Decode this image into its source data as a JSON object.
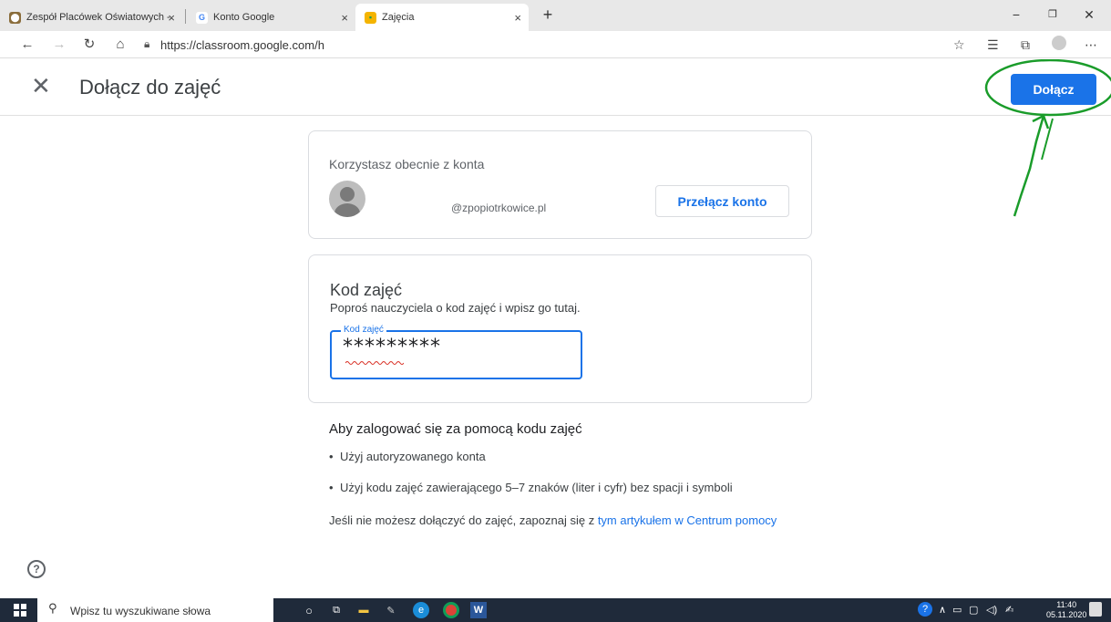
{
  "browser": {
    "tabs": [
      {
        "title": "Zespół Placówek Oświatowych -",
        "favicon": "school-favicon"
      },
      {
        "title": "Konto Google",
        "favicon": "google-favicon",
        "favicon_text": "G"
      },
      {
        "title": "Zajęcia",
        "favicon": "classroom-favicon",
        "active": true
      }
    ],
    "tab_close": "×",
    "new_tab": "+",
    "url": "https://classroom.google.com/h"
  },
  "page": {
    "title": "Dołącz do zajęć",
    "join_button": "Dołącz",
    "account_card": {
      "label": "Korzystasz obecnie z konta",
      "email": "@zpopiotrkowice.pl",
      "switch_button": "Przełącz konto"
    },
    "code_card": {
      "title": "Kod zajęć",
      "subtitle": "Poproś nauczyciela o kod zajęć i wpisz go tutaj.",
      "field_label": "Kod zajęć",
      "field_value": "*********"
    },
    "info": {
      "heading": "Aby zalogować się za pomocą kodu zajęć",
      "bullets": [
        "Użyj autoryzowanego konta",
        "Użyj kodu zajęć zawierającego 5–7 znaków (liter i cyfr) bez spacji i symboli"
      ],
      "help_prefix": "Jeśli nie możesz dołączyć do zajęć, zapoznaj się z ",
      "help_link": "tym artykułem w Centrum pomocy"
    }
  },
  "taskbar": {
    "search_placeholder": "Wpisz tu wyszukiwane słowa",
    "time": "11:40",
    "date": "05.11.2020"
  },
  "colors": {
    "accent": "#1a73e8",
    "annotation": "#1a9c2a",
    "taskbar": "#1f2a3a"
  }
}
